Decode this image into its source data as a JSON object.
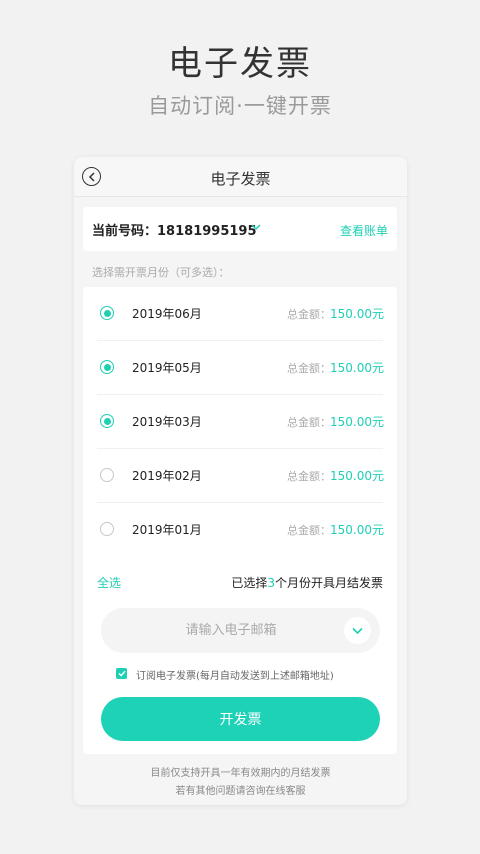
{
  "hero": {
    "title": "电子发票",
    "subtitle": "自动订阅·一键开票"
  },
  "nav": {
    "title": "电子发票",
    "back_icon": "back-circle-icon"
  },
  "account": {
    "label_prefix": "当前号码：",
    "number": "18181995195",
    "bill_link": "查看账单"
  },
  "choose_hint": "选择需开票月份（可多选）：",
  "months": [
    {
      "month": "2019年06月",
      "total_label": "总金额：",
      "amount": "150.00元",
      "checked": true
    },
    {
      "month": "2019年05月",
      "total_label": "总金额：",
      "amount": "150.00元",
      "checked": true
    },
    {
      "month": "2019年03月",
      "total_label": "总金额：",
      "amount": "150.00元",
      "checked": true
    },
    {
      "month": "2019年02月",
      "total_label": "总金额：",
      "amount": "150.00元",
      "checked": false
    },
    {
      "month": "2019年01月",
      "total_label": "总金额：",
      "amount": "150.00元",
      "checked": false
    }
  ],
  "summary": {
    "select_all": "全选",
    "prefix": "已选择",
    "count": "3",
    "suffix": "个月份开具月结发票"
  },
  "email": {
    "placeholder": "请输入电子邮箱",
    "value": ""
  },
  "subscribe": {
    "label": "订阅电子发票(每月自动发送到上述邮箱地址)",
    "checked": true
  },
  "issue_button": "开发票",
  "footer": {
    "line1": "目前仅支持开具一年有效期内的月结发票",
    "line2": "若有其他问题请咨询在线客服"
  },
  "colors": {
    "accent": "#1fcfb4",
    "background": "#f2f2f2"
  }
}
